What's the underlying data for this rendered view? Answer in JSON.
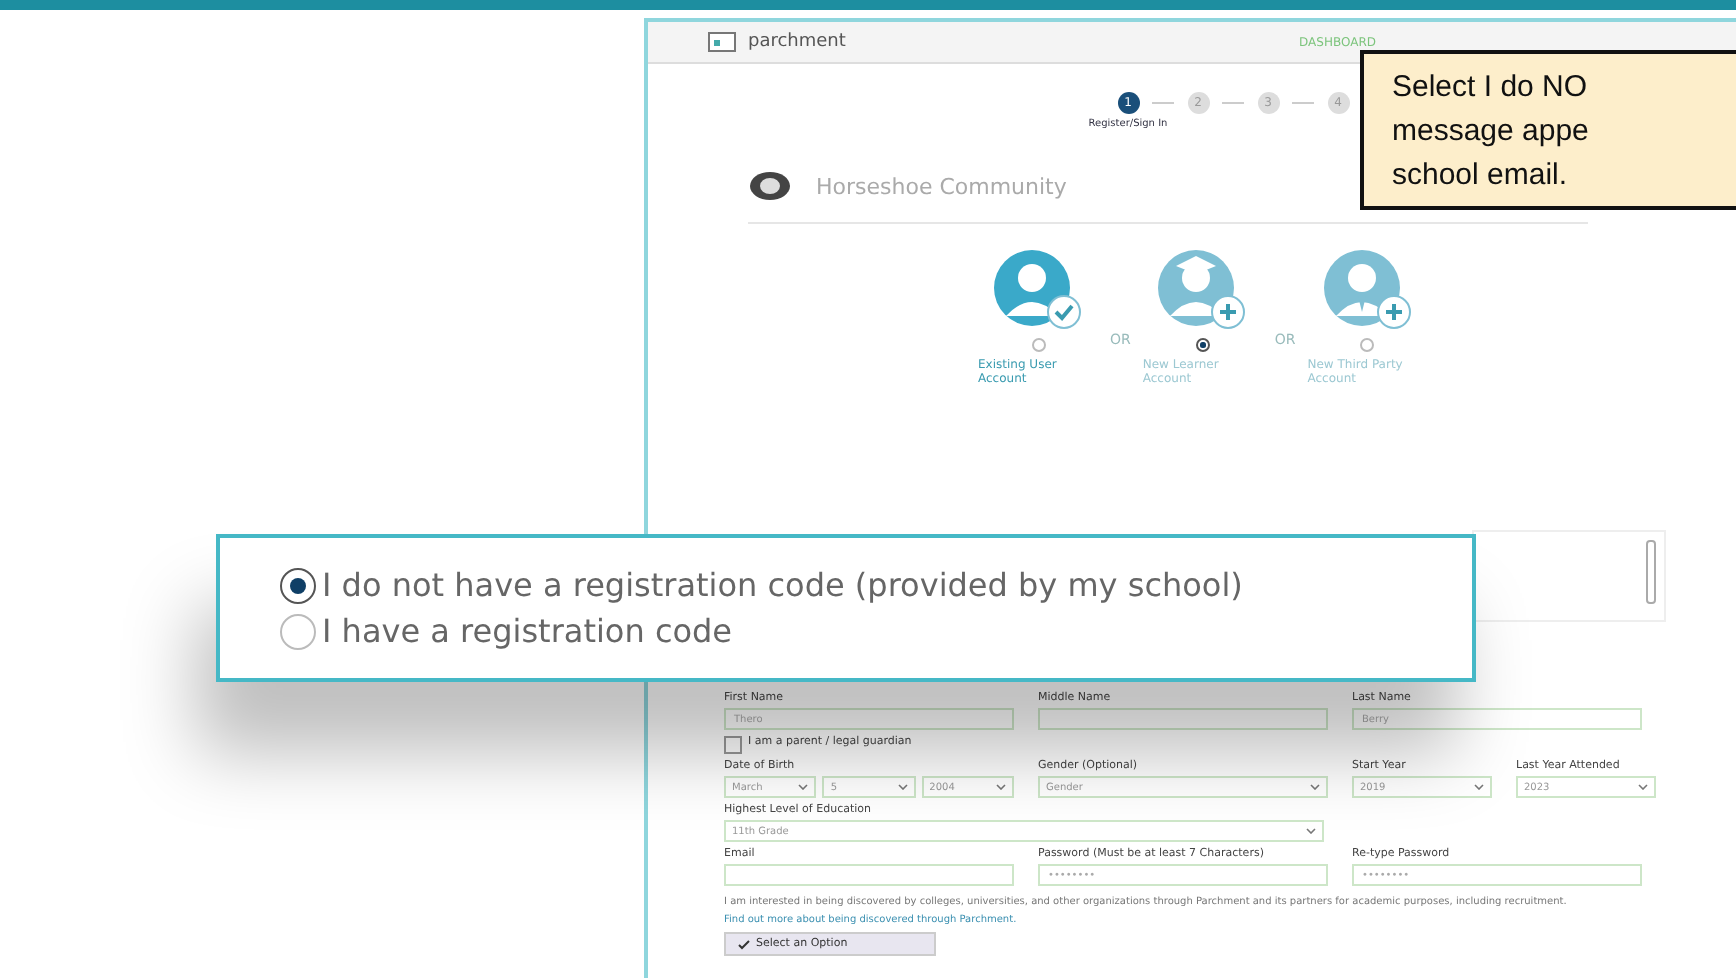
{
  "site": {
    "logo": "parchment",
    "nav": [
      "DASHBOARD"
    ]
  },
  "steps": [
    {
      "number": "1",
      "selected": true,
      "label": "Register/Sign In"
    },
    {
      "number": "2",
      "selected": false
    },
    {
      "number": "3",
      "selected": false
    },
    {
      "number": "4",
      "selected": false
    }
  ],
  "school": {
    "name": "Horseshoe Community"
  },
  "account_types": [
    {
      "title": "Existing User Account",
      "selected": false,
      "kind": "check"
    },
    {
      "title": "New Learner Account",
      "selected": true,
      "kind": "graduate"
    },
    {
      "title": "New Third Party Account",
      "selected": false,
      "kind": "suit"
    }
  ],
  "separators": [
    "OR",
    "OR"
  ],
  "registration_options": [
    {
      "label": "I do not have a registration code (provided by my school)",
      "selected": true
    },
    {
      "label": "I have a registration code",
      "selected": false
    }
  ],
  "form": {
    "rows": [
      [
        {
          "label": "First Name",
          "value": "Thero"
        },
        {
          "label": "Middle Name"
        },
        {
          "label": "Last Name",
          "value": "Berry"
        }
      ],
      [
        {
          "label": "Date of Birth",
          "selects": [
            "March",
            "5",
            "2004"
          ]
        },
        {
          "label": "Gender",
          "hint": "(Optional)",
          "selects": [
            "Gender"
          ]
        },
        {
          "label": "Start Year",
          "selects": [
            "2019"
          ]
        },
        {
          "label": "Last Year Attended",
          "selects": [
            "2023"
          ]
        }
      ],
      [
        {
          "label": "Highest Level of Education",
          "selects": [
            "11th Grade"
          ]
        }
      ],
      [
        {
          "label": "Email"
        },
        {
          "label": "Password",
          "hint": "(Must be at least 7 Characters)",
          "value": "••••••••"
        },
        {
          "label": "Re-type Password",
          "value": "••••••••"
        }
      ]
    ],
    "guardian": {
      "label": "I am a parent / legal guardian",
      "checked": false
    },
    "consent": "I am interested in being discovered by colleges, universities, and other organizations through Parchment and its partners for academic purposes, including recruitment.",
    "consent_link": "Find out more about being discovered through Parchment.",
    "option_select": "Select an Option"
  },
  "callout": [
    "Select I do NO",
    "message appe",
    "school email."
  ]
}
